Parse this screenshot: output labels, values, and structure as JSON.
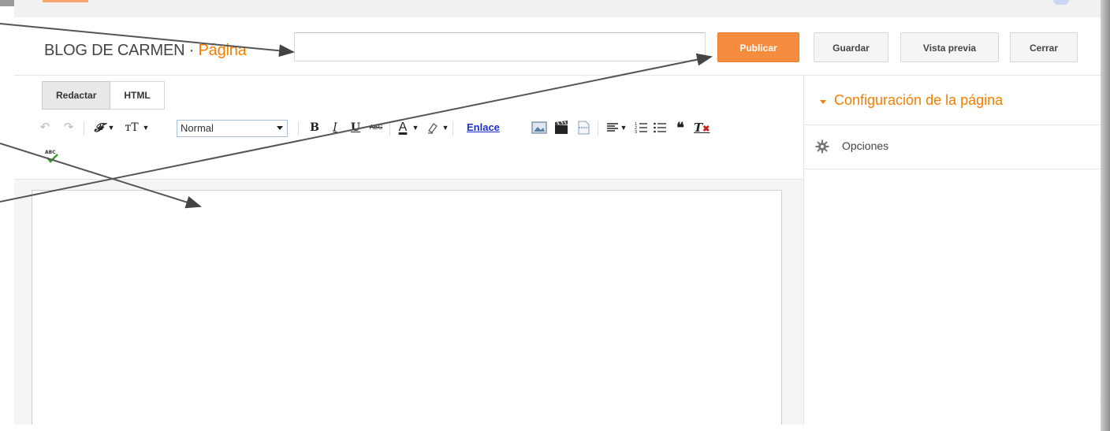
{
  "header": {
    "blog_name": "BLOG DE CARMEN",
    "separator": " · ",
    "section": "Página",
    "title_value": ""
  },
  "actions": {
    "publish": "Publicar",
    "save": "Guardar",
    "preview": "Vista previa",
    "close": "Cerrar"
  },
  "editor": {
    "tabs": [
      "Redactar",
      "HTML"
    ],
    "active_tab": "Redactar",
    "toolbar": {
      "undo_icon": "↶",
      "redo_icon": "↷",
      "font_icon": "𝓕",
      "size_icon": "тT",
      "style_value": "Normal",
      "bold_icon": "B",
      "italic_icon": "I",
      "underline_icon": "U",
      "strike_icon": "ABC",
      "text_color_icon": "A",
      "link_label": "Enlace",
      "quote_icon": "❝",
      "clear_format_icon": "T"
    },
    "content": ""
  },
  "sidebar": {
    "heading": "Configuración de la página",
    "options_label": "Opciones"
  },
  "colors": {
    "accent": "#f57d00",
    "publish_bg": "#f68c3d",
    "link": "#1a2fd1"
  }
}
